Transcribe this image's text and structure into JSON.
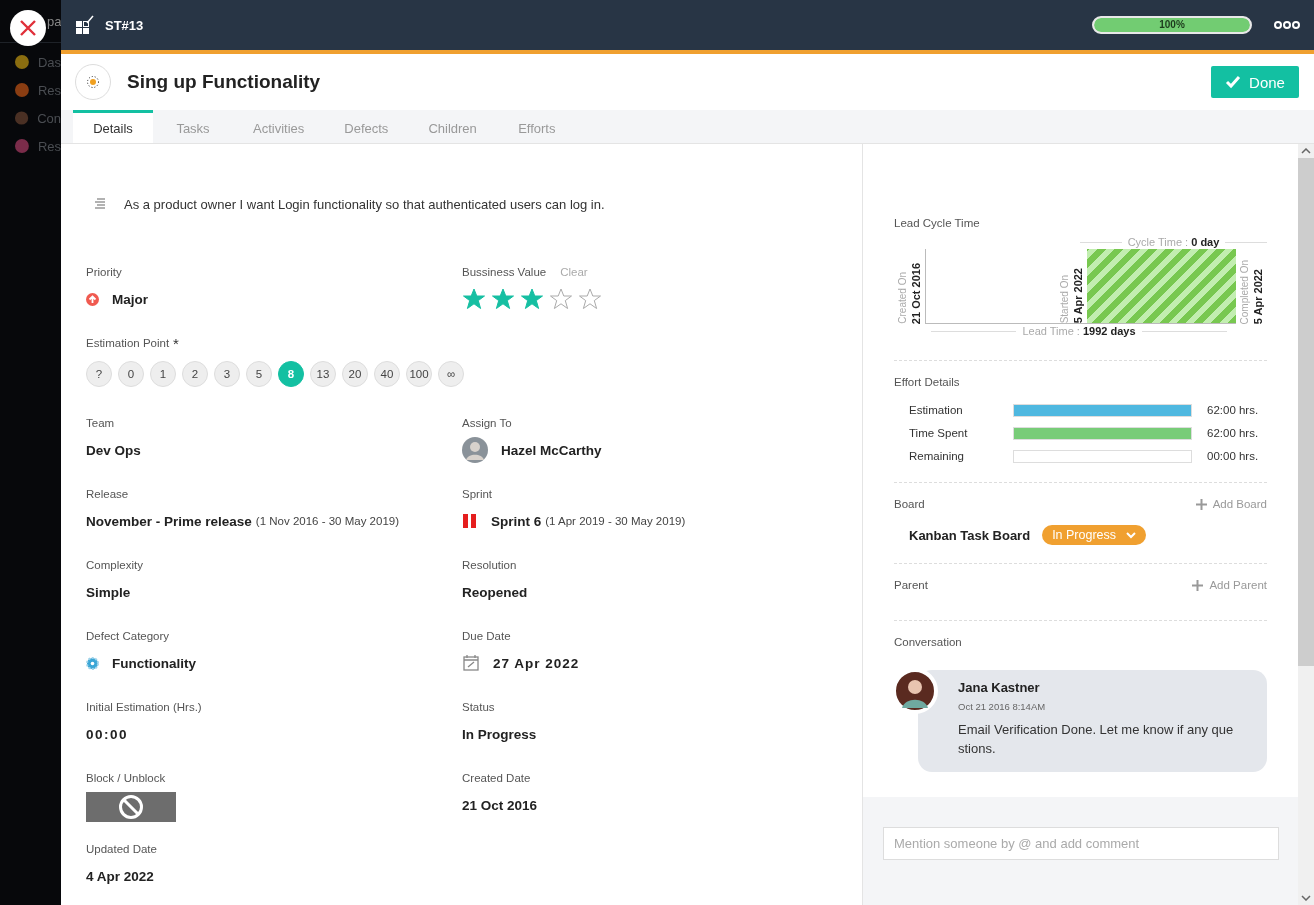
{
  "backdrop": {
    "header": "pa",
    "items": [
      {
        "label": "Das",
        "color": "#8a6d10"
      },
      {
        "label": "Res",
        "color": "#8a3d12"
      },
      {
        "label": "Con",
        "color": "#4a3024"
      },
      {
        "label": "Res",
        "color": "#7a2c4a"
      }
    ]
  },
  "header": {
    "id": "ST#13",
    "progress": {
      "level": 1,
      "reading": "100%"
    }
  },
  "title": "Sing up Functionality",
  "done_button": "Done",
  "tabs": [
    {
      "label": "Details",
      "selected": true
    },
    {
      "label": "Tasks",
      "selected": false
    },
    {
      "label": "Activities",
      "selected": false
    },
    {
      "label": "Defects",
      "selected": false
    },
    {
      "label": "Children",
      "selected": false
    },
    {
      "label": "Efforts",
      "selected": false
    }
  ],
  "description": "As a product owner I want Login functionality so that authenticated users can log in.",
  "fields": [
    {
      "kind": "priority",
      "label": "Priority",
      "value": "Major"
    },
    {
      "kind": "stars",
      "label": "Bussiness Value",
      "action": "Clear",
      "stars": 3
    },
    {
      "kind": "points",
      "label": "Estimation Point",
      "mark": "*",
      "points": [
        {
          "label": "?",
          "selected": false
        },
        {
          "label": "0",
          "selected": false
        },
        {
          "label": "1",
          "selected": false
        },
        {
          "label": "2",
          "selected": false
        },
        {
          "label": "3",
          "selected": false
        },
        {
          "label": "5",
          "selected": false
        },
        {
          "label": "8",
          "selected": true
        },
        {
          "label": "13",
          "selected": false
        },
        {
          "label": "20",
          "selected": false
        },
        {
          "label": "40",
          "selected": false
        },
        {
          "label": "100",
          "selected": false
        },
        {
          "label": "∞",
          "selected": false
        }
      ]
    },
    {
      "kind": "text",
      "label": "Team",
      "value": "Dev Ops"
    },
    {
      "kind": "person",
      "label": "Assign To",
      "value": "Hazel McCarthy"
    },
    {
      "kind": "range",
      "label": "Release",
      "value": "November - Prime release",
      "note": "(1 Nov 2016 - 30 May 2019)"
    },
    {
      "kind": "sprint",
      "label": "Sprint",
      "value": "Sprint 6",
      "note": "(1 Apr 2019 - 30 May 2019)"
    },
    {
      "kind": "text",
      "label": "Complexity",
      "value": "Simple"
    },
    {
      "kind": "text",
      "label": "Resolution",
      "value": "Reopened"
    },
    {
      "kind": "category",
      "label": "Defect Category",
      "value": "Functionality"
    },
    {
      "kind": "date",
      "label": "Due Date",
      "value": "27 Apr 2022"
    },
    {
      "kind": "time",
      "label": "Initial Estimation (Hrs.)",
      "value": "00:00"
    },
    {
      "kind": "text",
      "label": "Status",
      "value": "In Progress"
    },
    {
      "kind": "block",
      "label": "Block / Unblock"
    },
    {
      "kind": "text",
      "label": "Created Date",
      "value": "21 Oct 2016"
    },
    {
      "kind": "text",
      "label": "Updated Date",
      "value": "4 Apr 2022"
    }
  ],
  "lead_cycle": {
    "title": "Lead Cycle Time",
    "created_label": "Created On",
    "created_date": "21 Oct 2016",
    "started_label": "Started On",
    "started_date": "5 Apr 2022",
    "completed_label": "Completed On",
    "completed_date": "5 Apr 2022",
    "cycle_label": "Cycle Time :",
    "cycle_value": "0 day",
    "lead_label": "Lead Time :",
    "lead_value": "1992 days"
  },
  "effort": {
    "title": "Effort Details",
    "rows": [
      {
        "label": "Estimation",
        "level": 1,
        "color": "#4fb8e0",
        "reading": "62:00 hrs."
      },
      {
        "label": "Time Spent",
        "level": 1,
        "color": "#78cc78",
        "reading": "62:00 hrs."
      },
      {
        "label": "Remaining",
        "level": 0,
        "reading": "00:00 hrs."
      }
    ]
  },
  "board": {
    "title": "Board",
    "action": "Add Board",
    "name": "Kanban Task Board",
    "status": "In Progress"
  },
  "parent": {
    "title": "Parent",
    "action": "Add Parent"
  },
  "conversation": {
    "title": "Conversation",
    "messages": [
      {
        "author": "Jana Kastner",
        "time": "Oct 21 2016 8:14AM",
        "text": "Email Verification Done. Let me know if any questions."
      }
    ]
  },
  "comment": {
    "placeholder": "Mention someone by @ and add comment"
  }
}
